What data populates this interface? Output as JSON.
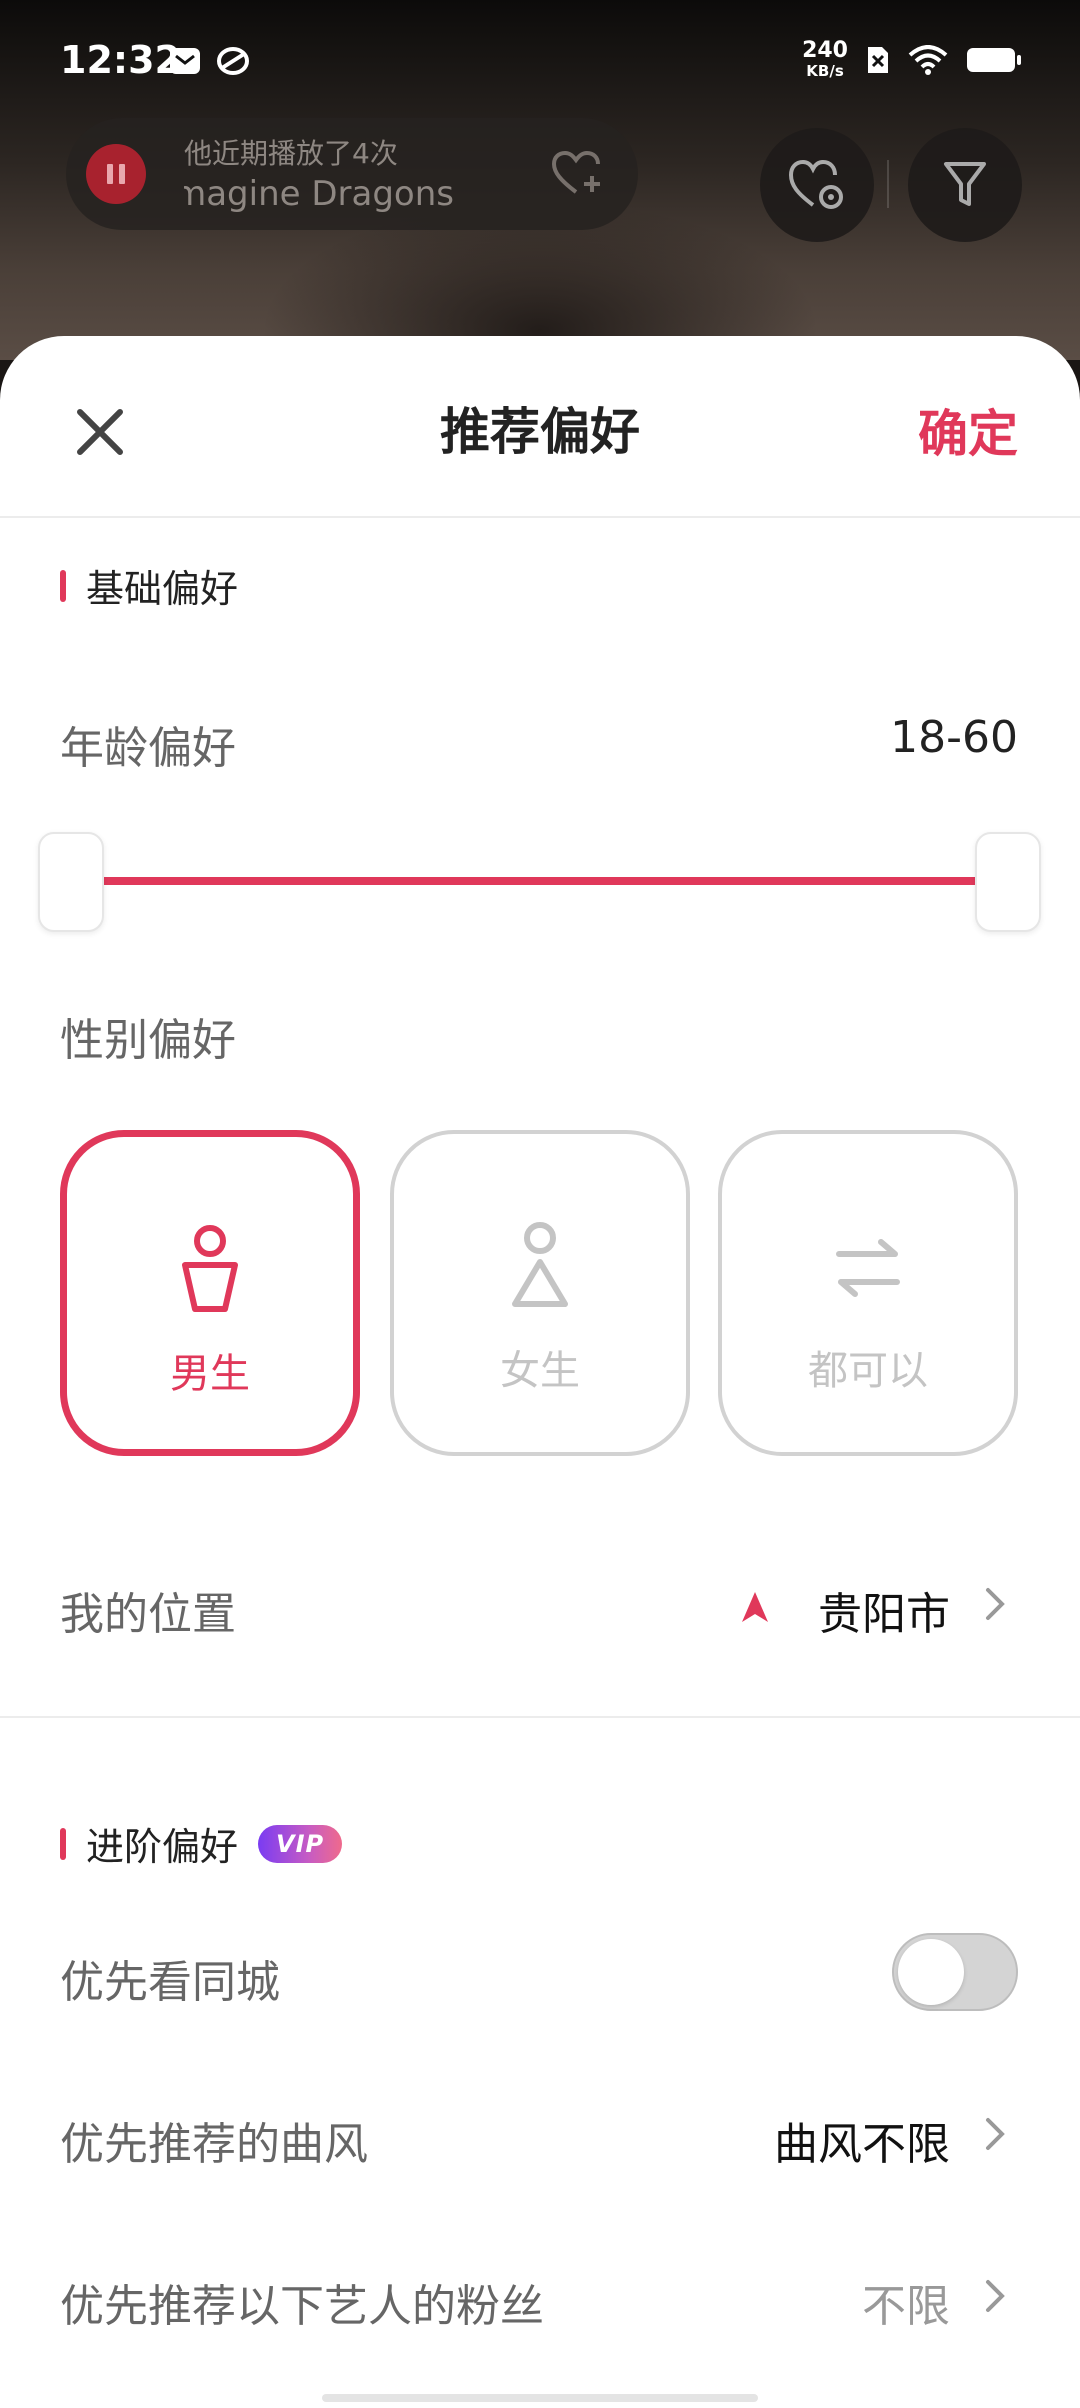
{
  "status_bar": {
    "time": "12:32",
    "net_speed_value": "240",
    "net_speed_unit": "KB/s",
    "icons": [
      "mail-icon",
      "app-icon",
      "no-sim-icon",
      "wifi-icon",
      "battery-icon"
    ]
  },
  "now_playing": {
    "subtitle": "他近期播放了4次",
    "title": "Imagine Dragons"
  },
  "sheet": {
    "title": "推荐偏好",
    "confirm_label": "确定"
  },
  "basic": {
    "section_title": "基础偏好",
    "age_label": "年龄偏好",
    "age_value": "18-60",
    "age_min": 18,
    "age_max": 60,
    "gender_label": "性别偏好",
    "gender_options": [
      {
        "label": "男生",
        "icon": "male-icon",
        "selected": true
      },
      {
        "label": "女生",
        "icon": "female-icon",
        "selected": false
      },
      {
        "label": "都可以",
        "icon": "swap-icon",
        "selected": false
      }
    ],
    "location_label": "我的位置",
    "location_value": "贵阳市"
  },
  "advanced": {
    "section_title": "进阶偏好",
    "vip_badge": "VIP",
    "same_city_label": "优先看同城",
    "same_city_enabled": false,
    "genre_label": "优先推荐的曲风",
    "genre_value": "曲风不限",
    "artist_fans_label": "优先推荐以下艺人的粉丝",
    "artist_fans_value": "不限"
  },
  "colors": {
    "accent": "#e0385a",
    "muted": "#c4c4c4",
    "label": "#666666"
  }
}
